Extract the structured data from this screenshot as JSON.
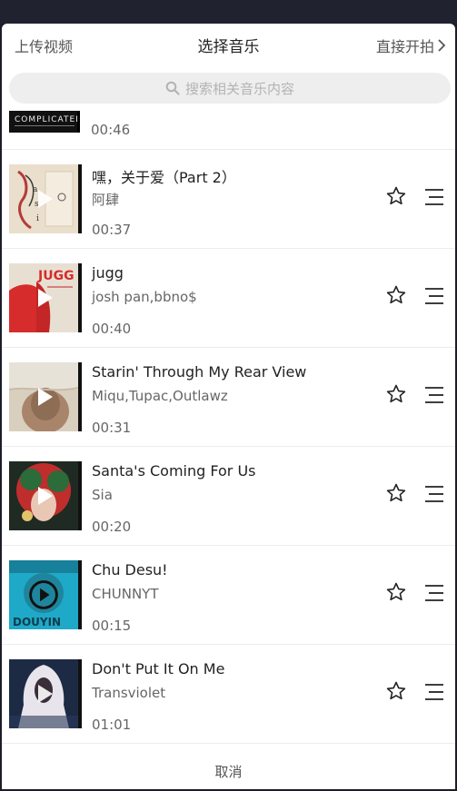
{
  "header": {
    "upload_label": "上传视频",
    "title": "选择音乐",
    "start_label": "直接开拍"
  },
  "search": {
    "placeholder": "搜索相关音乐内容"
  },
  "partial_item": {
    "cover_text": "COMPLICATED",
    "duration": "00:46"
  },
  "tracks": [
    {
      "title": "嘿，关于爱（Part 2）",
      "artist": "阿肆",
      "duration": "00:37"
    },
    {
      "title": "jugg",
      "artist": "josh pan,bbno$",
      "duration": "00:40",
      "cover_text": "JUGG"
    },
    {
      "title": "Starin' Through My Rear View",
      "artist": "Miqu,Tupac,Outlawz",
      "duration": "00:31"
    },
    {
      "title": "Santa's Coming For Us",
      "artist": "Sia",
      "duration": "00:20"
    },
    {
      "title": "Chu Desu!",
      "artist": "CHUNNYT",
      "duration": "00:15",
      "cover_text": "DOUYIN"
    },
    {
      "title": "Don't Put It On Me",
      "artist": "Transviolet",
      "duration": "01:01"
    }
  ],
  "footer": {
    "cancel_label": "取消"
  },
  "colors": {
    "accent_text": "#222222",
    "secondary_text": "#666666",
    "search_bg": "#eeeeee"
  }
}
